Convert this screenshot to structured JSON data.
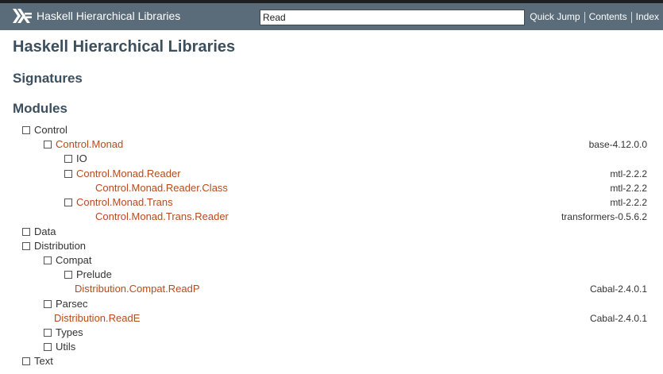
{
  "header": {
    "title": "Haskell Hierarchical Libraries",
    "search_value": "Read",
    "links": [
      "Quick Jump",
      "Contents",
      "Index"
    ]
  },
  "page": {
    "title": "Haskell Hierarchical Libraries",
    "sections": [
      "Signatures",
      "Modules"
    ]
  },
  "tree": [
    {
      "label": "Control",
      "link": false,
      "box": true,
      "package": ""
    },
    {
      "label": "Control.Monad",
      "link": true,
      "box": true,
      "package": "base-4.12.0.0"
    },
    {
      "label": "IO",
      "link": false,
      "box": true,
      "package": ""
    },
    {
      "label": "Control.Monad.Reader",
      "link": true,
      "box": true,
      "package": "mtl-2.2.2"
    },
    {
      "label": "Control.Monad.Reader.Class",
      "link": true,
      "box": false,
      "package": "mtl-2.2.2"
    },
    {
      "label": "Control.Monad.Trans",
      "link": true,
      "box": true,
      "package": "mtl-2.2.2"
    },
    {
      "label": "Control.Monad.Trans.Reader",
      "link": true,
      "box": false,
      "package": "transformers-0.5.6.2"
    },
    {
      "label": "Data",
      "link": false,
      "box": true,
      "package": ""
    },
    {
      "label": "Distribution",
      "link": false,
      "box": true,
      "package": ""
    },
    {
      "label": "Compat",
      "link": false,
      "box": true,
      "package": ""
    },
    {
      "label": "Prelude",
      "link": false,
      "box": true,
      "package": ""
    },
    {
      "label": "Distribution.Compat.ReadP",
      "link": true,
      "box": false,
      "package": "Cabal-2.4.0.1"
    },
    {
      "label": "Parsec",
      "link": false,
      "box": true,
      "package": ""
    },
    {
      "label": "Distribution.ReadE",
      "link": true,
      "box": false,
      "package": "Cabal-2.4.0.1"
    },
    {
      "label": "Types",
      "link": false,
      "box": true,
      "package": ""
    },
    {
      "label": "Utils",
      "link": false,
      "box": true,
      "package": ""
    },
    {
      "label": "Text",
      "link": false,
      "box": true,
      "package": ""
    }
  ],
  "colors": {
    "header_bg": "#5a6b79",
    "heading": "#3b4f5e",
    "module_link": "#b84a1b"
  },
  "icons": {
    "logo": "haskell-logo-icon",
    "expander": "square-expander-icon"
  }
}
